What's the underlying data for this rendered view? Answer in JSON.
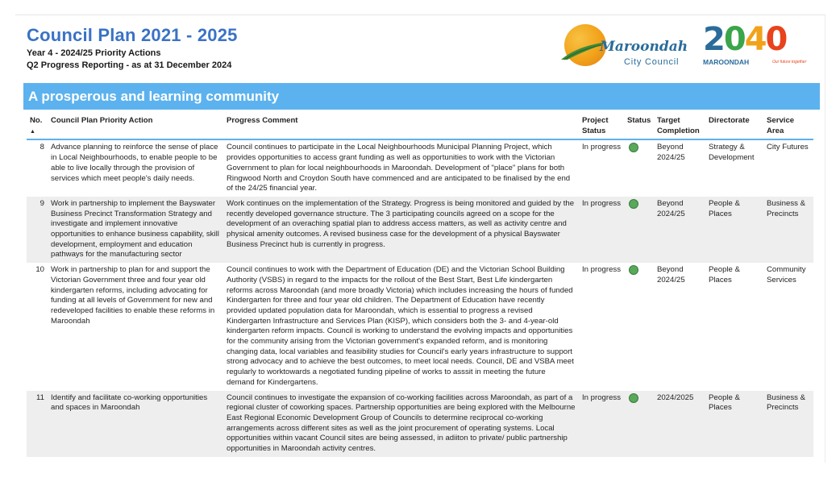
{
  "header": {
    "title": "Council Plan 2021 - 2025",
    "subtitle_1": "Year 4 - 2024/25 Priority Actions",
    "subtitle_2": "Q2 Progress Reporting - as at 31 December 2024"
  },
  "logos": {
    "maroondah_name": "Maroondah",
    "maroondah_city": "City Council",
    "vision_digits": "2040",
    "vision_label": "MAROONDAH",
    "vision_tagline": "Our future together"
  },
  "section": {
    "title": "A prosperous and learning community"
  },
  "table": {
    "columns": [
      "No.",
      "Council Plan Priority Action",
      "Progress Comment",
      "Project Status",
      "Status",
      "Target Completion",
      "Directorate",
      "Service Area"
    ],
    "sort_indicator": "▲",
    "status_color": "#58a95a",
    "rows": [
      {
        "no": "8",
        "action": "Advance planning to reinforce the sense of place in Local Neighbourhoods, to enable people to be able to live locally through the provision of services which meet people's daily needs.",
        "comment": "Council continues to participate in the Local Neighbourhoods Municipal Planning Project, which provides opportunities to access grant funding as well as opportunities to work with the Victorian Government to plan for local neighbourhoods in Maroondah. Development of \"place\" plans for both Ringwood North and Croydon South have commenced and are anticipated to be finalised by the end of the 24/25 financial year.",
        "project_status": "In progress",
        "status_icon": "green-circle",
        "target": "Beyond 2024/25",
        "directorate": "Strategy & Development",
        "service_area": "City Futures"
      },
      {
        "no": "9",
        "action": "Work in partnership to implement the Bayswater Business Precinct Transformation Strategy and investigate and implement innovative opportunities to enhance business capability, skill development, employment and education pathways for the manufacturing sector",
        "comment": "Work continues on the implementation of the Strategy. Progress is being monitored and guided by the recently developed governance structure. The 3 participating councils agreed on a scope for the development of an overaching spatial plan to address access matters, as well as activity centre and physical amenity outcomes. A revised business case for the development of a physical Bayswater Business Precinct hub is currently in progress.",
        "project_status": "In progress",
        "status_icon": "green-circle",
        "target": "Beyond 2024/25",
        "directorate": "People & Places",
        "service_area": "Business & Precincts"
      },
      {
        "no": "10",
        "action": "Work in partnership to plan for and support the Victorian Government three and four year old kindergarten reforms, including advocating for funding at all levels of Government for new and redeveloped facilities to enable these reforms in Maroondah",
        "comment": "Council continues to work with the Department of Education (DE) and the Victorian School Building Authority (VSBS) in regard to the impacts for the rollout of the Best Start, Best Life kindergarten reforms across Maroondah (and more broadly Victoria) which includes increasing the hours of funded Kindergarten for three and four year old children. The Department of Education have recently provided updated population data for Maroondah, which is essential to progress a revised Kindergarten Infrastructure and Services Plan (KISP), which considers both the 3- and 4-year-old kindergarten reform impacts. Council is working to understand the evolving impacts and opportunities for the community arising from the Victorian government's expanded reform, and is monitoring changing data, local variables and feasibility studies for Council's early years infrastructure to support strong advocacy and to achieve the best outcomes, to meet local needs. Council, DE and VSBA meet regularly to worktowards a negotiated funding pipeline of works to asssit in meeting the future demand for Kindergartens.",
        "project_status": "In progress",
        "status_icon": "green-circle",
        "target": "Beyond 2024/25",
        "directorate": "People & Places",
        "service_area": "Community Services"
      },
      {
        "no": "11",
        "action": "Identify and facilitate co-working opportunities and spaces in Maroondah",
        "comment": "Council continues to investigate the expansion of co-working facilities across Maroondah, as part of a regional cluster of coworking spaces. Partnership opportunities are being explored with the Melbourne East Regional Economic Development Group of Councils to determine reciprocal co-working arrangements across different sites as well as the joint procurement of operating systems. Local opportunities within vacant Council sites are being assessed, in adiiton to private/ public partnership opportunities in Maroondah activity centres.",
        "project_status": "In progress",
        "status_icon": "green-circle",
        "target": "2024/2025",
        "directorate": "People & Places",
        "service_area": "Business & Precincts"
      }
    ]
  }
}
